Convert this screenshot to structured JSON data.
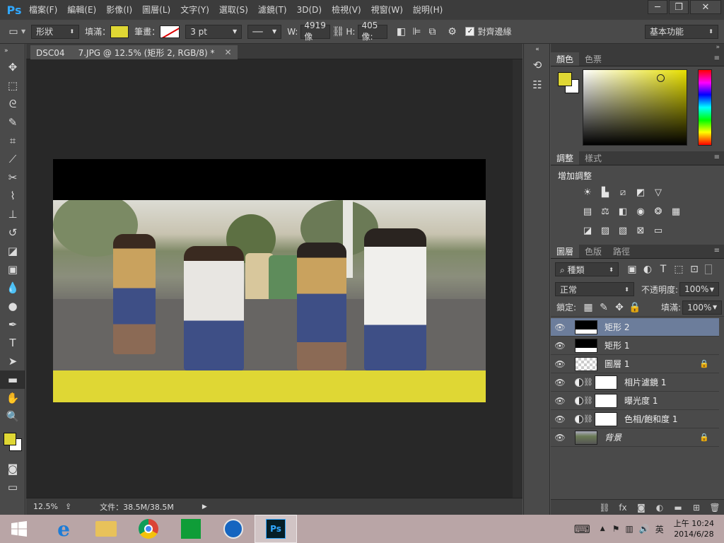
{
  "app": {
    "logo": "Ps"
  },
  "menu": [
    "檔案(F)",
    "編輯(E)",
    "影像(I)",
    "圖層(L)",
    "文字(Y)",
    "選取(S)",
    "濾鏡(T)",
    "3D(D)",
    "檢視(V)",
    "視窗(W)",
    "說明(H)"
  ],
  "window_controls": {
    "minimize": "─",
    "restore": "❐",
    "close": "✕"
  },
  "options": {
    "mode": "形狀",
    "fill_label": "填滿：",
    "stroke_label": "筆畫：",
    "stroke_width": "3 pt",
    "w_label": "W:",
    "w_value": "4919 像",
    "h_label": "H:",
    "h_value": "405 像:",
    "align_edges": "對齊邊緣",
    "workspace": "基本功能"
  },
  "document": {
    "tab_title": "DSC04     7.JPG @ 12.5% (矩形 2, RGB/8) *",
    "zoom": "12.5%",
    "file_info": "文件：38.5M/38.5M"
  },
  "panels": {
    "color_tabs": [
      "顏色",
      "色票"
    ],
    "adjust_tabs": [
      "調整",
      "樣式"
    ],
    "adjust_title": "增加調整",
    "layers_tabs": [
      "圖層",
      "色版",
      "路徑"
    ],
    "filter_kind": "種類",
    "blend_mode": "正常",
    "opacity_label": "不透明度:",
    "opacity_value": "100%",
    "lock_label": "鎖定:",
    "fill_label": "填滿:",
    "fill_value": "100%"
  },
  "layers": [
    {
      "name": "矩形 2",
      "type": "shape",
      "selected": true
    },
    {
      "name": "矩形 1",
      "type": "shape",
      "selected": false
    },
    {
      "name": "圖層 1",
      "type": "pixel",
      "selected": false
    },
    {
      "name": "相片濾鏡 1",
      "type": "adjustment",
      "selected": false
    },
    {
      "name": "曝光度 1",
      "type": "adjustment",
      "selected": false
    },
    {
      "name": "色相/飽和度 1",
      "type": "adjustment",
      "selected": false
    },
    {
      "name": "背景",
      "type": "background",
      "selected": false
    }
  ],
  "taskbar": {
    "time": "上午 10:24",
    "date": "2014/6/28",
    "ime": "英"
  },
  "colors": {
    "foreground": "#dfd734",
    "background": "#ffffff",
    "selection": "#6c7d9b"
  }
}
